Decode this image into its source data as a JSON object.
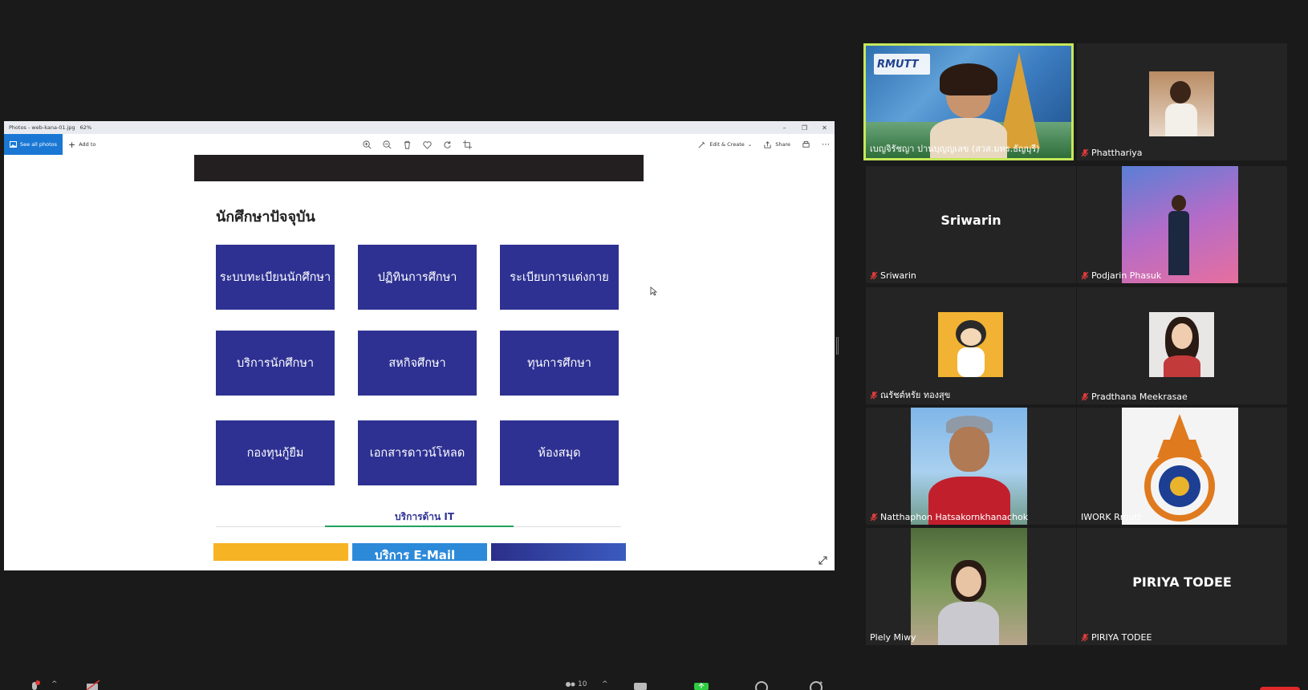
{
  "share_window": {
    "title": "Photos - web-kana-01.jpg",
    "zoom": "62%",
    "see_all_label": "See all photos",
    "add_to_label": "Add to",
    "edit_create_label": "Edit & Create",
    "share_label": "Share"
  },
  "page": {
    "section_title": "นักศึกษาปัจจุบัน",
    "tiles": [
      "ระบบทะเบียนนักศึกษา",
      "ปฏิทินการศึกษา",
      "ระเบียบการแต่งกาย",
      "บริการนักศึกษา",
      "สหกิจศึกษา",
      "ทุนการศึกษา",
      "กองทุนกู้ยืม",
      "เอกสารดาวน์โหลด",
      "ห้องสมุด"
    ],
    "it_heading": "บริการด้าน IT",
    "banner_email": "บริการ E-Mail"
  },
  "participants": [
    {
      "name": "เบญจิรัชญา ปานบุญญเลข (สวส.มทร.ธัญบุรี)",
      "muted": false,
      "active": true,
      "logo_text": "RMUTT"
    },
    {
      "name": "Phatthariya",
      "muted": true
    },
    {
      "name": "Sriwarin",
      "muted": true,
      "display": "Sriwarin"
    },
    {
      "name": "Podjarin Phasuk",
      "muted": true
    },
    {
      "name": "ณรัชต์หรัย  ทองสุข",
      "muted": true
    },
    {
      "name": "Pradthana Meekrasae",
      "muted": true
    },
    {
      "name": "Natthaphon Hatsakornkhanachok",
      "muted": true
    },
    {
      "name": "IWORK Rmutt",
      "muted": false
    },
    {
      "name": "Plely Miwy",
      "muted": false
    },
    {
      "name": "PIRIYA TODEE",
      "muted": true,
      "display": "PIRIYA TODEE"
    }
  ],
  "bottom_bar": {
    "participant_count": "10"
  },
  "colors": {
    "tile_blue": "#2e3192",
    "active_speaker": "#c6e85a",
    "mute_red": "#e03c3c"
  }
}
